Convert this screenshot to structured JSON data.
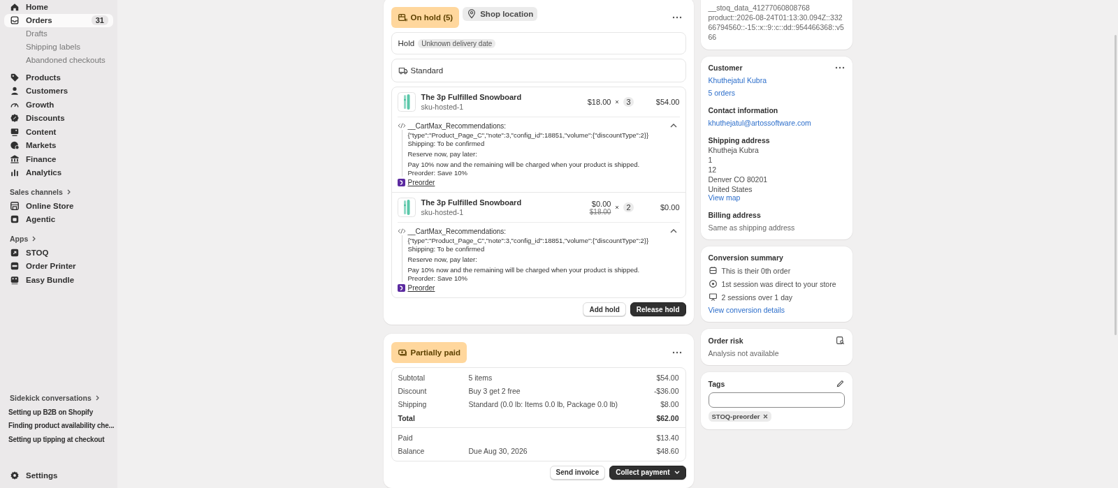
{
  "sidebar": {
    "nav": [
      {
        "label": "Home",
        "selected": false
      },
      {
        "label": "Orders",
        "selected": true,
        "badge": "31",
        "children": [
          {
            "label": "Drafts"
          },
          {
            "label": "Shipping labels"
          },
          {
            "label": "Abandoned checkouts"
          }
        ]
      },
      {
        "label": "Products",
        "selected": false
      },
      {
        "label": "Customers",
        "selected": false
      },
      {
        "label": "Growth",
        "selected": false
      },
      {
        "label": "Discounts",
        "selected": false
      },
      {
        "label": "Content",
        "selected": false
      },
      {
        "label": "Markets",
        "selected": false
      },
      {
        "label": "Finance",
        "selected": false
      },
      {
        "label": "Analytics",
        "selected": false
      }
    ],
    "sales_channels": {
      "heading": "Sales channels",
      "items": [
        {
          "label": "Online Store"
        },
        {
          "label": "Agentic"
        }
      ]
    },
    "apps": {
      "heading": "Apps",
      "items": [
        {
          "label": "STOQ"
        },
        {
          "label": "Order Printer"
        },
        {
          "label": "Easy Bundle"
        }
      ]
    },
    "sidekick": {
      "heading": "Sidekick conversations",
      "items": [
        "Setting up B2B on Shopify",
        "Finding product availability che...",
        "Setting up tipping at checkout"
      ]
    },
    "settings": {
      "label": "Settings"
    }
  },
  "fulfillment_card": {
    "badges": [
      {
        "label": "On hold (5)",
        "kind": "hold"
      },
      {
        "label": "Shop location",
        "kind": "location"
      }
    ],
    "hold": {
      "label": "Hold",
      "tag": "Unknown delivery date"
    },
    "delivery": {
      "method": "Standard"
    },
    "line_items": [
      {
        "title": "The 3p Fulfilled Snowboard",
        "sku": "sku-hosted-1",
        "price": "$18.00",
        "quantity": "3",
        "total": "$54.00",
        "property_name": "__CartMax_Recommendations:",
        "expanded": true,
        "note_groups": [
          [
            "{\"type\":\"Product_Page_C\",\"note\":3,\"config_id\":18851,\"volume\":{\"discountType\":2}}",
            "Shipping:  To be confirmed"
          ],
          [
            "Reserve now, pay later:"
          ],
          [
            "Pay 10% now and the remaining will be charged when your product is shipped.",
            "Preorder: Save 10%"
          ]
        ],
        "app_link": "Preorder"
      },
      {
        "title": "The 3p Fulfilled Snowboard",
        "sku": "sku-hosted-1",
        "price": "$0.00",
        "original_price": "$18.00",
        "quantity": "2",
        "total": "$0.00",
        "property_name": "__CartMax_Recommendations:",
        "expanded": true,
        "note_groups": [
          [
            "{\"type\":\"Product_Page_C\",\"note\":3,\"config_id\":18851,\"volume\":{\"discountType\":2}}",
            "Shipping:  To be confirmed"
          ],
          [
            "Reserve now, pay later:"
          ],
          [
            "Pay 10% now and the remaining will be charged when your product is shipped.",
            "Preorder: Save 10%"
          ]
        ],
        "app_link": "Preorder"
      }
    ],
    "buttons": [
      {
        "label": "Add hold",
        "kind": "secondary"
      },
      {
        "label": "Release hold",
        "kind": "primary"
      }
    ]
  },
  "payment_card": {
    "badge": {
      "label": "Partially paid"
    },
    "summary": [
      {
        "label": "Subtotal",
        "detail": "5 items",
        "amount": "$54.00",
        "bold": false
      },
      {
        "label": "Discount",
        "detail": "Buy 3 get 2 free",
        "amount": "-$36.00",
        "bold": false
      },
      {
        "label": "Shipping",
        "detail": "Standard (0.0 lb: Items 0.0 lb, Package 0.0 lb)",
        "amount": "$8.00",
        "bold": false
      },
      {
        "label": "Total",
        "amount": "$62.00",
        "bold": true
      }
    ],
    "paid": [
      {
        "label": "Paid",
        "amount": "$13.40"
      },
      {
        "label": "Balance",
        "detail": "Due Aug 30, 2026",
        "amount": "$48.60"
      }
    ],
    "buttons": [
      {
        "label": "Send invoice",
        "kind": "secondary",
        "menu": false
      },
      {
        "label": "Collect payment",
        "kind": "primary",
        "menu": true
      }
    ]
  },
  "notes_card": {
    "lines": [
      "__stoq_data_41277060808768",
      "product::2026-08-24T01:13:30.094Z::33266794560::-15::x::9::c::dd::954466368::v566"
    ]
  },
  "customer_card": {
    "title": "Customer",
    "name": "Khuthejatul Kubra",
    "orders": "5 orders",
    "contact": {
      "heading": "Contact information",
      "email": "khuthejatul@artossoftware.com"
    },
    "shipping": {
      "heading": "Shipping address",
      "lines": [
        "Khutheja Kubra",
        "1",
        "12",
        "Denver CO 80201",
        "United States"
      ],
      "link": "View map"
    },
    "billing": {
      "heading": "Billing address",
      "text": "Same as shipping address"
    }
  },
  "conversion_card": {
    "title": "Conversion summary",
    "items": [
      "This is their 0th order",
      "1st session was direct to your store",
      "2 sessions over 1 day"
    ],
    "link": "View conversion details"
  },
  "risk_card": {
    "title": "Order risk",
    "text": "Analysis not available"
  },
  "tags_card": {
    "title": "Tags",
    "tags": [
      "STOQ-preorder"
    ]
  }
}
